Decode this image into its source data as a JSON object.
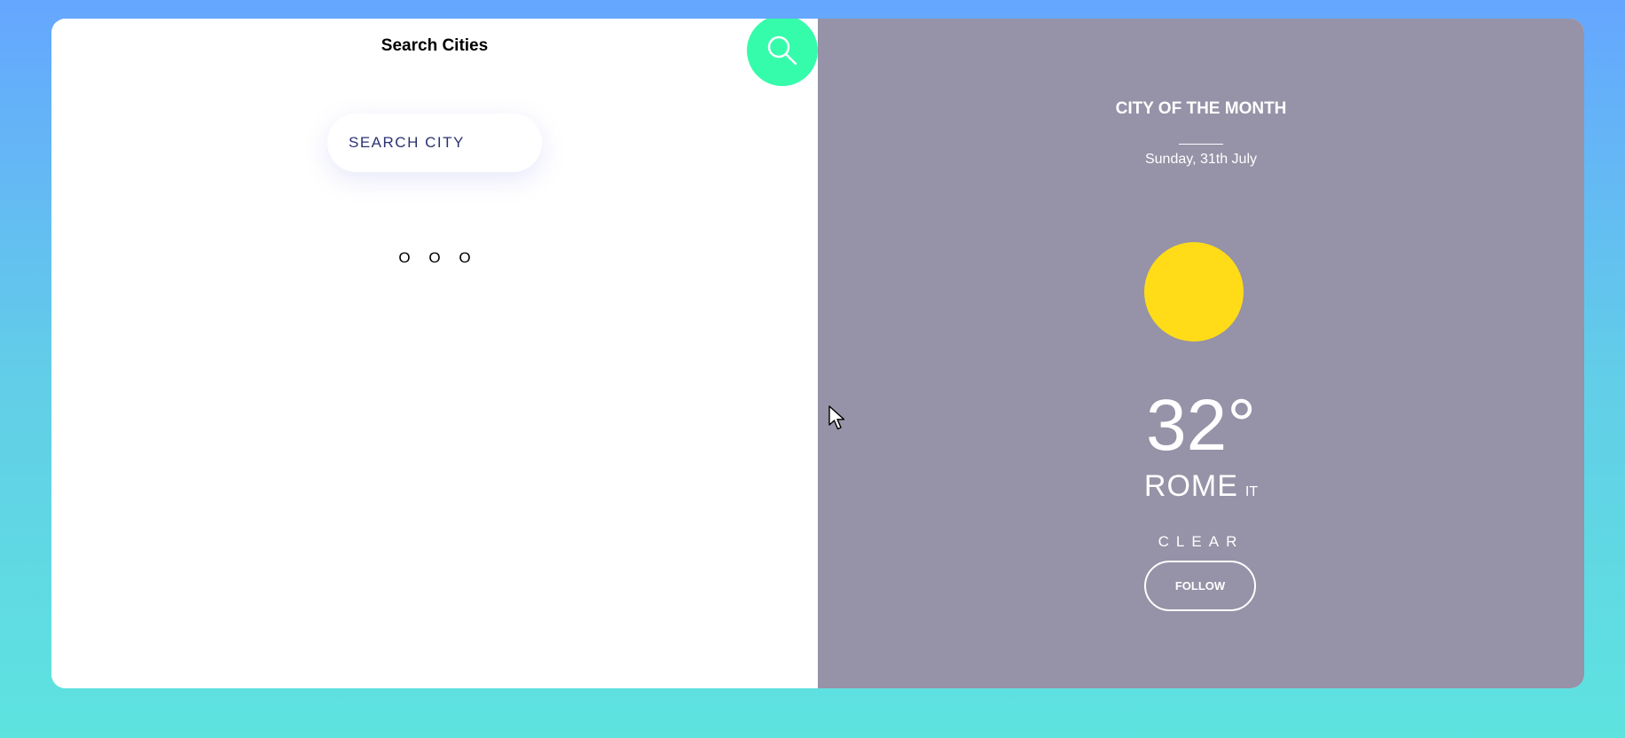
{
  "search_panel": {
    "title": "Search Cities",
    "search_placeholder": "SEARCH CITY",
    "loading_dots": [
      "O",
      "O",
      "O"
    ]
  },
  "city_panel": {
    "heading": "CITY OF THE MONTH",
    "date": "Sunday, 31th July",
    "weather_icon": "sun-icon",
    "temperature": "32°",
    "city": "ROME",
    "country": "IT",
    "condition": "CLEAR",
    "follow_label": "FOLLOW"
  },
  "icons": {
    "search_button": "search-icon",
    "cursor": "mouse-cursor-icon"
  },
  "colors": {
    "background_top": "#65a6ff",
    "background_bottom": "#5ee3df",
    "search_button": "#35fcab",
    "city_panel": "#9692a7",
    "sun": "#ffdc17",
    "search_text": "#2b3370"
  }
}
